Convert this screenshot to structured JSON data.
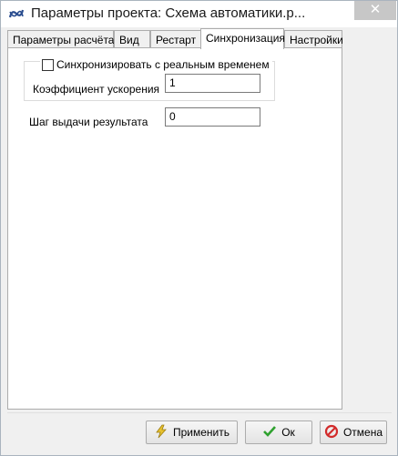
{
  "window": {
    "title": "Параметры проекта: Схема автоматики.р..."
  },
  "title_buttons": {
    "close": "✕"
  },
  "tabs": [
    {
      "label": "Параметры расчёта",
      "active": false
    },
    {
      "label": "Вид",
      "active": false
    },
    {
      "label": "Рестарт",
      "active": false
    },
    {
      "label": "Синхронизация",
      "active": true
    },
    {
      "label": "Настройки",
      "active": false
    }
  ],
  "sync": {
    "realtime_label": "Синхронизировать с реальным временем",
    "realtime_checked": false,
    "acceleration_label": "Коэффициент ускорения",
    "acceleration_value": "1",
    "output_step_label": "Шаг выдачи результата",
    "output_step_value": "0"
  },
  "buttons": {
    "apply": "Применить",
    "ok": "Ок",
    "cancel": "Отмена"
  },
  "icons": {
    "app": "app-logo-icon",
    "apply": "lightning-icon",
    "ok": "checkmark-icon",
    "cancel": "cancel-icon"
  },
  "colors": {
    "ok_green": "#2fa12f",
    "cancel_red": "#d22b2b",
    "apply_yellow": "#e8c22e"
  }
}
